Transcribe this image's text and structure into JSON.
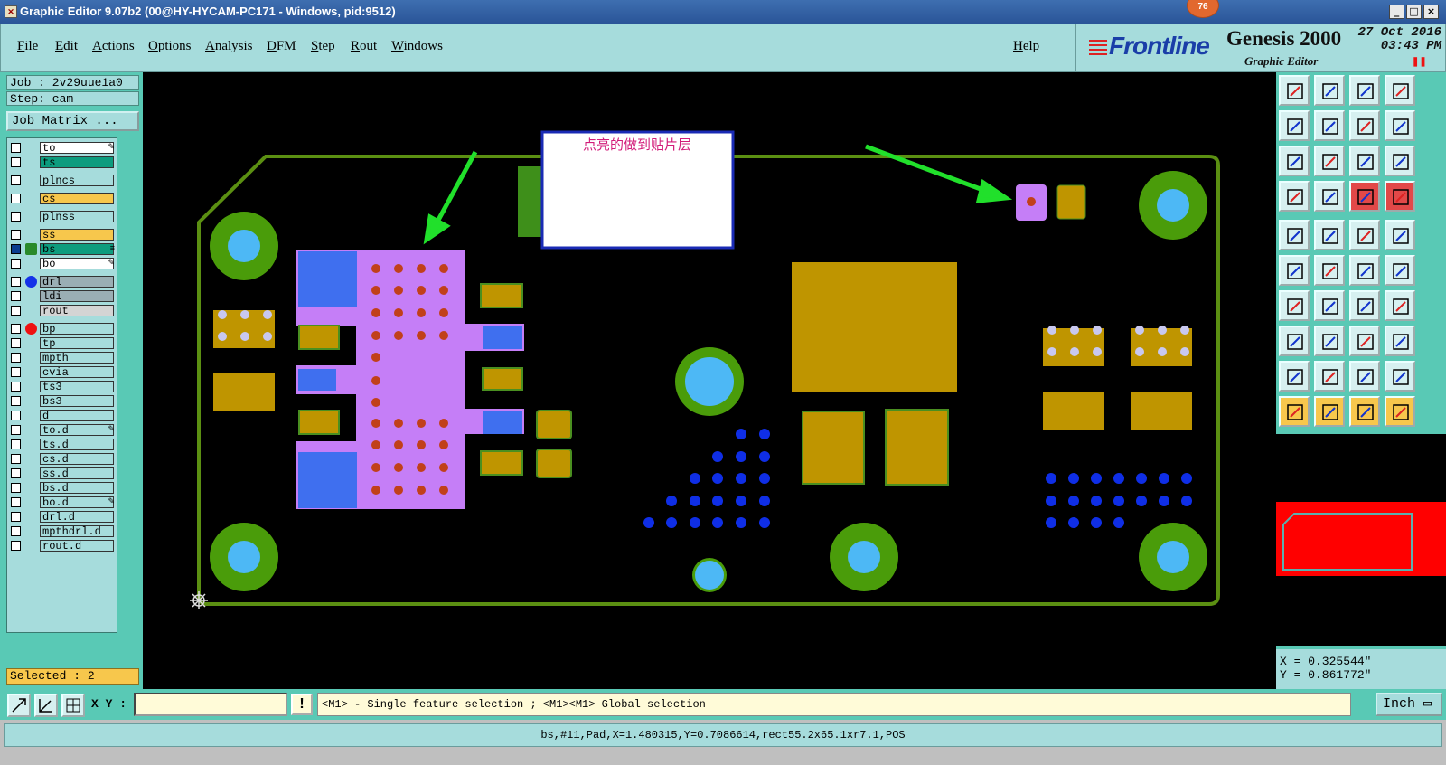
{
  "window": {
    "title": "Graphic Editor 9.07b2 (00@HY-HYCAM-PC171 - Windows, pid:9512)",
    "badge": "76",
    "min": "_",
    "max": "□",
    "close": "×"
  },
  "menu": {
    "items": [
      "File",
      "Edit",
      "Actions",
      "Options",
      "Analysis",
      "DFM",
      "Step",
      "Rout",
      "Windows"
    ],
    "help": "Help"
  },
  "brand": {
    "logo": "Frontline",
    "product": "Genesis 2000",
    "subtitle": "Graphic Editor",
    "date": "27 Oct 2016",
    "time": "03:43 PM"
  },
  "job": {
    "job_label": "Job : 2v29uue1a0",
    "step_label": "Step: cam",
    "matrix_button": "Job Matrix ..."
  },
  "layers": [
    {
      "name": "to",
      "color": "#ffffff",
      "mark": "✎"
    },
    {
      "name": "ts",
      "color": "#0d9c7e"
    },
    {
      "name": "plncs",
      "color": "#a6dcdc"
    },
    {
      "name": "cs",
      "color": "#f7c74c"
    },
    {
      "name": "plnss",
      "color": "#a6dcdc"
    },
    {
      "name": "ss",
      "color": "#f7c74c"
    },
    {
      "name": "bs",
      "color": "#0d9c7e",
      "mark": "≡"
    },
    {
      "name": "bo",
      "color": "#ffffff",
      "mark": "✎"
    },
    {
      "name": "drl",
      "color": "#9aaeb4"
    },
    {
      "name": "ldi",
      "color": "#9aaeb4"
    },
    {
      "name": "rout",
      "color": "#d4d4d4"
    },
    {
      "name": "bp",
      "color": "#a6dcdc"
    },
    {
      "name": "tp",
      "color": "#a6dcdc"
    },
    {
      "name": "mpth",
      "color": "#a6dcdc"
    },
    {
      "name": "cvia",
      "color": "#a6dcdc"
    },
    {
      "name": "ts3",
      "color": "#a6dcdc"
    },
    {
      "name": "bs3",
      "color": "#a6dcdc"
    },
    {
      "name": "d",
      "color": "#a6dcdc"
    },
    {
      "name": "to.d",
      "color": "#a6dcdc",
      "mark": "✎"
    },
    {
      "name": "ts.d",
      "color": "#a6dcdc"
    },
    {
      "name": "cs.d",
      "color": "#a6dcdc"
    },
    {
      "name": "ss.d",
      "color": "#a6dcdc"
    },
    {
      "name": "bs.d",
      "color": "#a6dcdc"
    },
    {
      "name": "bo.d",
      "color": "#a6dcdc",
      "mark": "✎"
    },
    {
      "name": "drl.d",
      "color": "#a6dcdc"
    },
    {
      "name": "mpthdrl.d",
      "color": "#a6dcdc"
    },
    {
      "name": "rout.d",
      "color": "#a6dcdc"
    }
  ],
  "selected": "Selected : 2",
  "annotation": {
    "text": "点亮的做到贴片层"
  },
  "coords": {
    "x": "X = 0.325544\"",
    "y": "Y = 0.861772\""
  },
  "bottom": {
    "xy_label": "X Y :",
    "xy_value": "",
    "warn": "!",
    "hint": "<M1> - Single feature selection ; <M1><M1> Global selection",
    "units": "Inch ▭"
  },
  "status": "bs,#11,Pad,X=1.480315,Y=0.7086614,rect55.2x65.1xr7.1,POS",
  "colors": {
    "pad": "#bf9500",
    "pad_edge": "#4a8f20",
    "selected": "#c57ef7",
    "via": "#0f2ee6",
    "hole_ring": "#4a9c0a",
    "hole": "#4db8f5",
    "outline": "#5b8f12",
    "drill_pad": "#3f6fef"
  }
}
